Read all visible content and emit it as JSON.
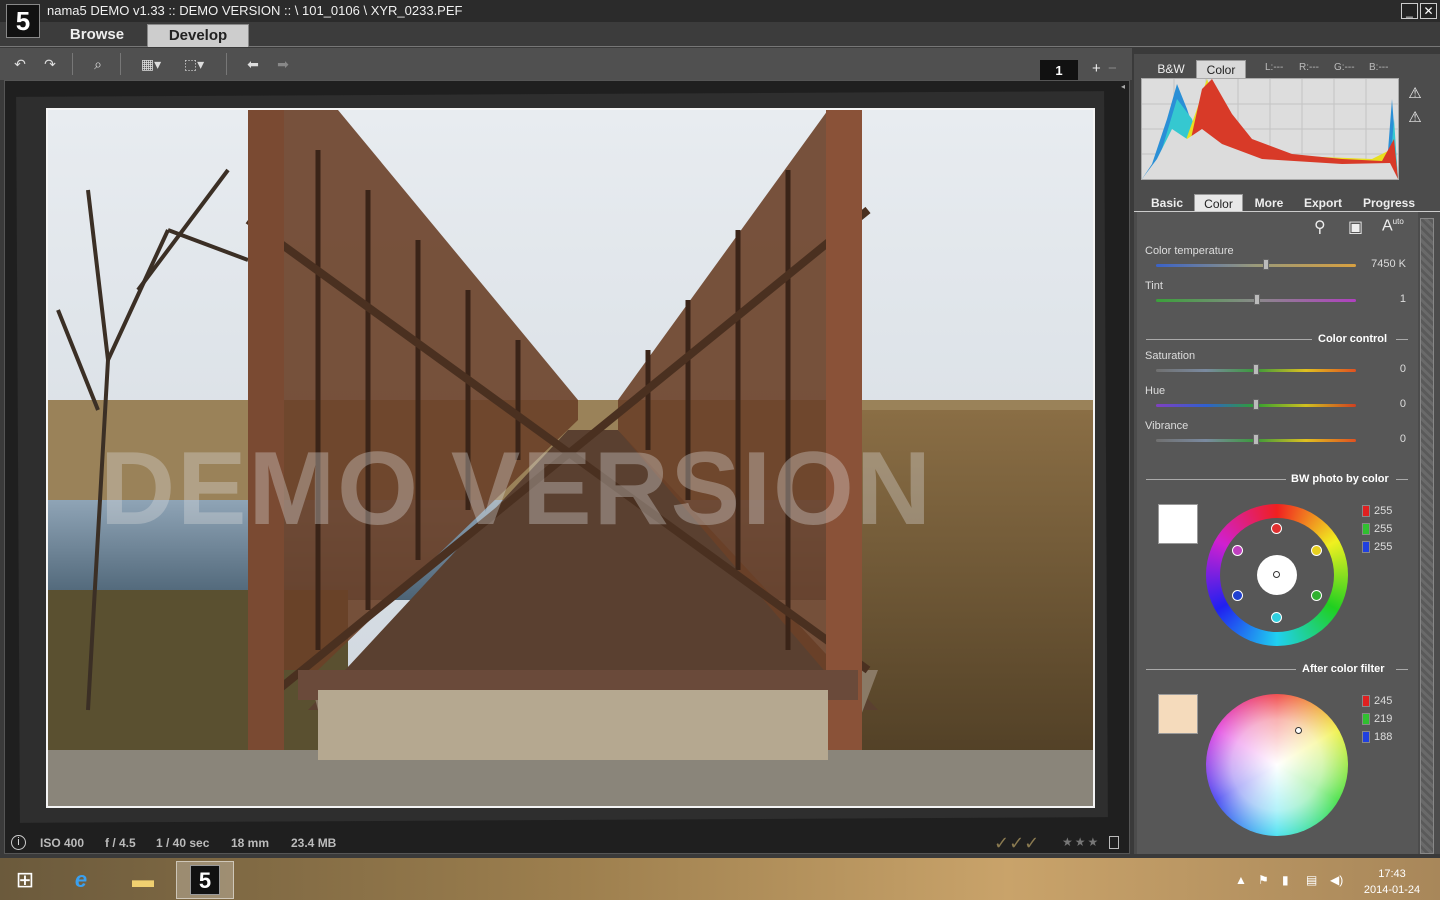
{
  "window": {
    "title": "nama5 DEMO v1.33 :: DEMO VERSION :: \\ 101_0106 \\ XYR_0233.PEF",
    "logo": "5",
    "minimize_icon": "minimize-icon",
    "close_icon": "close-icon"
  },
  "main_tabs": [
    {
      "label": "Browse",
      "active": false
    },
    {
      "label": "Develop",
      "active": true
    }
  ],
  "toolbar": {
    "icons": [
      "rotate-left-icon",
      "rotate-right-icon",
      "zoom-icon",
      "grid-icon",
      "crop-rotate-icon",
      "undo-icon",
      "redo-icon"
    ],
    "page_number": "1",
    "zoom_plus": "+",
    "zoom_minus": "−"
  },
  "viewer": {
    "watermark": "DEMO VERSION"
  },
  "info_bar": {
    "iso": "ISO 400",
    "aperture": "f / 4.5",
    "shutter": "1 / 40 sec",
    "focal": "18 mm",
    "size": "23.4 MB",
    "checks": "✓✓✓",
    "stars": "★★★"
  },
  "histogram": {
    "tabs": [
      {
        "label": "B&W",
        "active": false
      },
      {
        "label": "Color",
        "active": true
      }
    ],
    "readouts": [
      "L:---",
      "R:---",
      "G:---",
      "B:---"
    ]
  },
  "panel_tabs": [
    {
      "label": "Basic",
      "active": false
    },
    {
      "label": "Color",
      "active": true
    },
    {
      "label": "More",
      "active": false
    },
    {
      "label": "Export",
      "active": false
    },
    {
      "label": "Progress",
      "active": false
    }
  ],
  "color_panel": {
    "auto_label": "A",
    "auto_sup": "uto",
    "sliders_top": [
      {
        "label": "Color temperature",
        "value": "7450 K",
        "position": 0.55
      },
      {
        "label": "Tint",
        "value": "1",
        "position": 0.505
      }
    ],
    "color_control": {
      "title": "Color control",
      "sliders": [
        {
          "label": "Saturation",
          "value": "0",
          "position": 0.5
        },
        {
          "label": "Hue",
          "value": "0",
          "position": 0.5
        },
        {
          "label": "Vibrance",
          "value": "0",
          "position": 0.5
        }
      ]
    },
    "bw_by_color": {
      "title": "BW photo by color",
      "swatch": "#ffffff",
      "r": "255",
      "g": "255",
      "b": "255"
    },
    "after_filter": {
      "title": "After color filter",
      "swatch": "#f5dbbc",
      "r": "245",
      "g": "219",
      "b": "188"
    }
  },
  "taskbar": {
    "time": "17:43",
    "date": "2014-01-24",
    "app_label": "5"
  },
  "colors": {
    "accent_develop_tab": "#cdcdcd",
    "panel_bg": "#575757"
  }
}
